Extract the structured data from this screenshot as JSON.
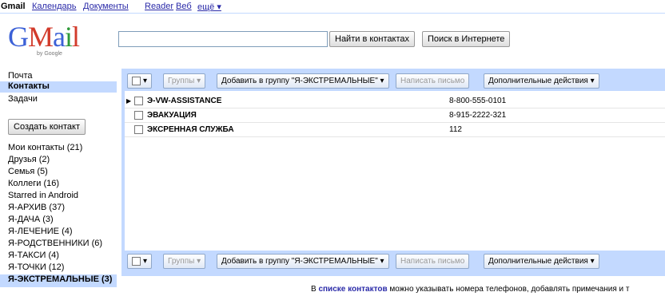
{
  "topbar": {
    "gmail": "Gmail",
    "calendar": "Календарь",
    "docs": "Документы",
    "reader": "Reader",
    "web": "Веб",
    "more": "ещё ▾"
  },
  "logo": {
    "text": "Gmail",
    "byline": "by Google"
  },
  "search": {
    "value": "",
    "find_contacts": "Найти в контактах",
    "web_search": "Поиск в Интернете"
  },
  "nav": {
    "mail": "Почта",
    "contacts": "Контакты",
    "tasks": "Задачи"
  },
  "create_contact": "Создать контакт",
  "groups": [
    "Мои контакты (21)",
    "Друзья (2)",
    "Семья (5)",
    "Коллеги (16)",
    "Starred in Android",
    "Я-АРХИВ (37)",
    "Я-ДАЧА (3)",
    "Я-ЛЕЧЕНИЕ (4)",
    "Я-РОДСТВЕННИКИ (6)",
    "Я-ТАКСИ (4)",
    "Я-ТОЧКИ (12)",
    "Я-ЭКСТРЕМАЛЬНЫЕ (3)"
  ],
  "toolbar": {
    "select": "▾",
    "groups": "Группы ▾",
    "add_to_group": "Добавить в группу \"Я-ЭКСТРЕМАЛЬНЫЕ\" ▾",
    "write": "Написать письмо",
    "more_actions": "Дополнительные действия ▾"
  },
  "contacts": [
    {
      "name": "Э-VW-ASSISTANCE",
      "phone": "8-800-555-0101"
    },
    {
      "name": "ЭВАКУАЦИЯ",
      "phone": "8-915-2222-321"
    },
    {
      "name": "ЭКСРЕННАЯ СЛУЖБА",
      "phone": "112"
    }
  ],
  "footer": {
    "prefix": "В ",
    "link": "списке контактов",
    "rest": " можно указывать номера телефонов, добавлять примечания и т"
  }
}
